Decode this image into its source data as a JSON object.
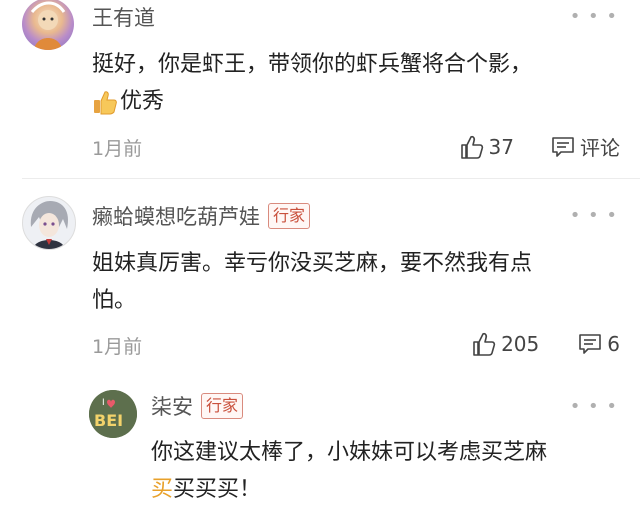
{
  "comments": [
    {
      "name": "王有道",
      "text_line1": "挺好，你是虾王，带领你的虾兵蟹将合个影，",
      "text_line2": "优秀",
      "emoji": "thumbs-up-emoji",
      "time": "1月前",
      "likes": "37",
      "reply_label": "评论"
    },
    {
      "name": "癞蛤蟆想吃葫芦娃",
      "badge": "行家",
      "text_line1": "姐妹真厉害。幸亏你没买芝麻，要不然我有点",
      "text_line2": "怕。",
      "time": "1月前",
      "likes": "205",
      "replies": "6"
    }
  ],
  "reply": {
    "name": "柒安",
    "badge": "行家",
    "text_line1": "你这建议太棒了，小妹妹可以考虑买芝麻",
    "text_line2_highlight": "买",
    "text_line2_rest": "买买买！",
    "avatar_text": "BEI"
  },
  "icons": {
    "more": "more-dots-icon",
    "like": "thumbs-up-icon",
    "comment": "comment-icon"
  }
}
